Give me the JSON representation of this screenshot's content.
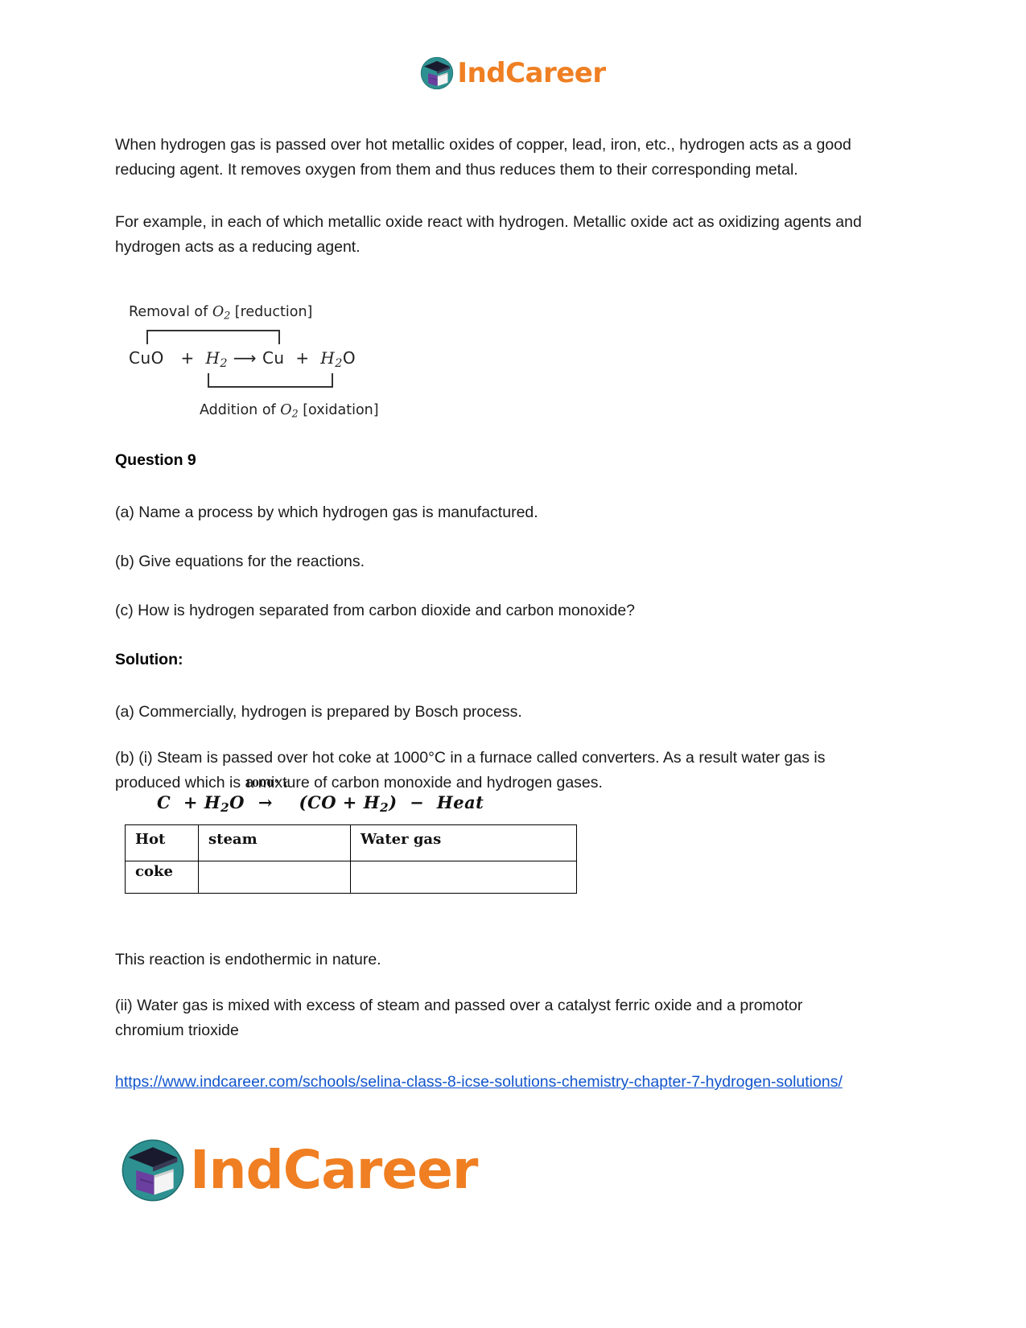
{
  "header": {
    "brand_icon": "graduation-cap-book-icon",
    "brand_first": "Ind",
    "brand_second": "Career",
    "brand_color": "#ef7f22",
    "icon_color": "#2b8e8e"
  },
  "body": {
    "paragraph_1": "When hydrogen gas is passed over hot metallic oxides of copper, lead, iron, etc., hydrogen acts as a good reducing agent. It removes oxygen from them and thus reduces them to their corresponding metal.",
    "paragraph_2": "For example, in each of which metallic oxide react with hydrogen. Metallic oxide act as oxidizing agents and hydrogen acts as a reducing agent."
  },
  "redox_figure": {
    "top_label_prefix": "Removal of ",
    "top_label_formula_base": "O",
    "top_label_formula_sub": "2",
    "top_label_suffix": " [reduction]",
    "equation_reactant_1": "CuO",
    "equation_plus_1": "+",
    "equation_reactant_2_base": "H",
    "equation_reactant_2_sub": "2",
    "equation_arrow": "⟶",
    "equation_product_1": "Cu",
    "equation_plus_2": "+",
    "equation_product_2_base": "H",
    "equation_product_2_sub": "2",
    "equation_product_2_tail": "O",
    "bottom_label_prefix": "Addition of ",
    "bottom_label_formula_base": "O",
    "bottom_label_formula_sub": "2",
    "bottom_label_suffix": " [oxidation]"
  },
  "question": {
    "heading": "Question 9",
    "items": [
      "(a) Name a process by which hydrogen gas is manufactured.",
      "(b) Give equations for the reactions.",
      "(c) How is hydrogen separated from carbon dioxide and carbon monoxide?"
    ]
  },
  "solution": {
    "heading": "Solution:",
    "answer_a": "(a) Commercially, hydrogen is prepared by Bosch process.",
    "answer_b_i": "(b) (i) Steam is passed over hot coke at 1000°C in a furnace called converters. As a result water gas is produced which is a mixture of carbon monoxide and hydrogen gases.",
    "note_endothermic": "This reaction is endothermic in nature.",
    "answer_b_ii": "(ii) Water gas is mixed with excess of steam and passed over a catalyst ferric oxide and a promotor chromium trioxide"
  },
  "water_gas_figure": {
    "reactant_1": "C",
    "plus_1": "+",
    "reactant_2_base": "H",
    "reactant_2_sub": "2",
    "reactant_2_tail": "O",
    "condition": "1000° c",
    "arrow": "→",
    "product": "(CO + H",
    "product_sub": "2",
    "product_tail": ")",
    "minus": "−",
    "heat": "Heat",
    "table": {
      "row_1": [
        "Hot",
        "steam",
        "Water gas"
      ],
      "row_2": [
        "coke",
        "",
        ""
      ]
    }
  },
  "footer": {
    "url_text": "https://www.indcareer.com/schools/selina-class-8-icse-solutions-chemistry-chapter-7-hydrogen-solutions/",
    "link_color": "#1155cc",
    "brand_icon": "graduation-cap-book-icon",
    "brand_first": "Ind",
    "brand_second": "Career"
  }
}
